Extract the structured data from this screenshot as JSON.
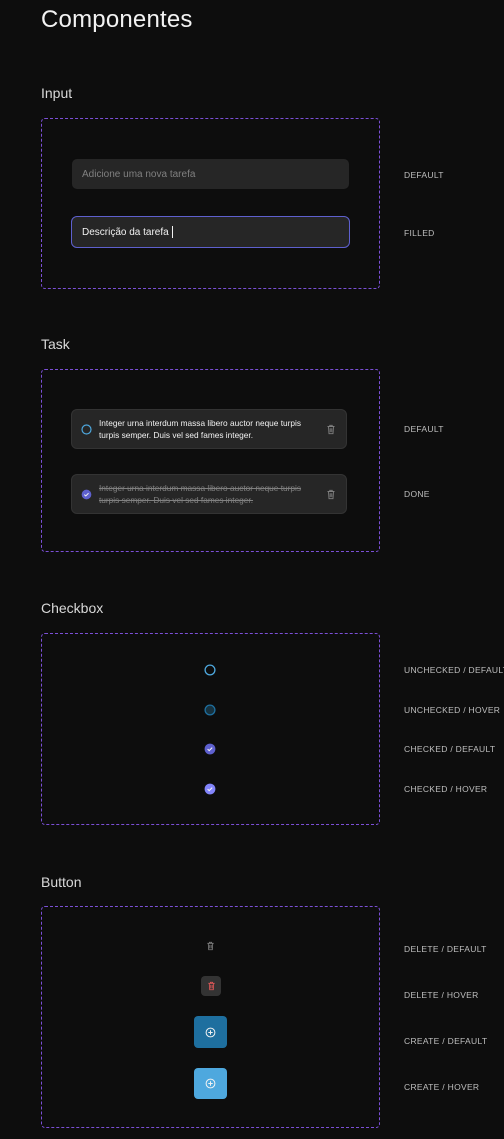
{
  "page": {
    "title": "Componentes"
  },
  "sections": {
    "input": {
      "title": "Input",
      "default_placeholder": "Adicione uma nova tarefa",
      "filled_value": "Descrição da tarefa",
      "labels": {
        "default": "DEFAULT",
        "filled": "FILLED"
      }
    },
    "task": {
      "title": "Task",
      "text": "Integer urna interdum massa libero auctor neque turpis turpis semper. Duis vel sed fames integer.",
      "labels": {
        "default": "DEFAULT",
        "done": "DONE"
      }
    },
    "checkbox": {
      "title": "Checkbox",
      "labels": {
        "unchecked_default": "UNCHECKED / DEFAULT",
        "unchecked_hover": "UNCHECKED / HOVER",
        "checked_default": "CHECKED / DEFAULT",
        "checked_hover": "CHECKED / HOVER"
      }
    },
    "button": {
      "title": "Button",
      "labels": {
        "delete_default": "DELETE / DEFAULT",
        "delete_hover": "DELETE / HOVER",
        "create_default": "CREATE / DEFAULT",
        "create_hover": "CREATE / HOVER"
      }
    }
  },
  "icons": {
    "check": "check-icon",
    "trash": "trash-icon",
    "plus_circle": "plus-circle-icon"
  },
  "colors": {
    "background": "#0d0d0d",
    "frame_border": "#7b4fd6",
    "blue": "#4ea8de",
    "blue_dark": "#1e6f9f",
    "purple": "#5e60ce",
    "purple_light": "#8284fa",
    "danger": "#e25858"
  }
}
